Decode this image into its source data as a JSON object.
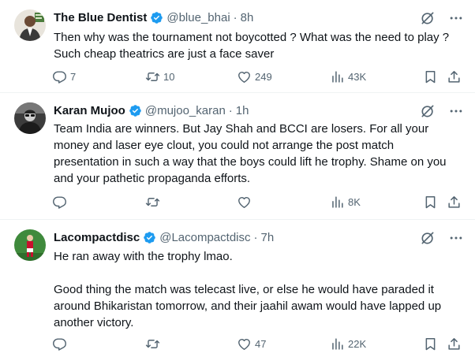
{
  "tweets": [
    {
      "name": "The Blue Dentist",
      "handle": "@blue_bhai",
      "time": "8h",
      "text": "Then why was the tournament not boycotted ? What was the need to play ?\nSuch cheap theatrics are just a face saver",
      "replies": "7",
      "retweets": "10",
      "likes": "249",
      "views": "43K"
    },
    {
      "name": "Karan Mujoo",
      "handle": "@mujoo_karan",
      "time": "1h",
      "text": "Team India are winners. But Jay Shah and BCCI are losers. For all your\nmoney and laser eye clout, you could not arrange the post match\npresentation in such a way that the boys could lift he trophy. Shame on you\nand your pathetic propaganda efforts.",
      "replies": "",
      "retweets": "",
      "likes": "",
      "views": "8K"
    },
    {
      "name": "Lacompactdisc",
      "handle": "@Lacompactdisc",
      "time": "7h",
      "text": "He ran away with the trophy lmao.\n\nGood thing the match was telecast live, or else he would have paraded it\naround Bhikaristan tomorrow, and their jaahil awam would have lapped up\nanother victory.",
      "replies": "",
      "retweets": "",
      "likes": "47",
      "views": "22K"
    }
  ],
  "colors": {
    "verified": "#1d9bf0",
    "secondary_text": "#536471",
    "divider": "#eff3f4"
  },
  "icons": [
    "verified-badge-icon",
    "grok-icon",
    "more-icon",
    "reply-icon",
    "retweet-icon",
    "like-icon",
    "views-icon",
    "bookmark-icon",
    "share-icon"
  ]
}
